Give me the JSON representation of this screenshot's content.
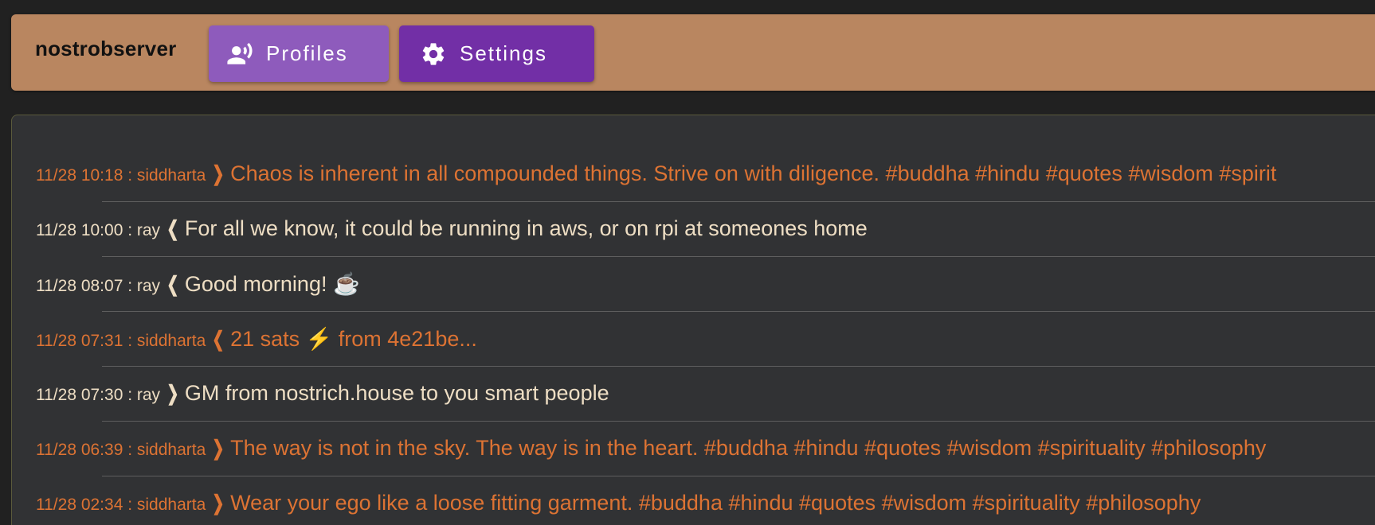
{
  "appbar": {
    "title": "nostrobserver",
    "profiles_label": "Profiles",
    "settings_label": "Settings",
    "color": "#b98660",
    "profiles_color": "#8e5bbc",
    "settings_color": "#722fa6"
  },
  "feed": {
    "notes": [
      {
        "meta": "11/28 10:18 : siddharta",
        "arrow": "❯",
        "text": "Chaos is inherent in all compounded things. Strive on with diligence. #buddha #hindu #quotes #wisdom #spirit",
        "color": "#dd7333"
      },
      {
        "meta": "11/28 10:00 : ray",
        "arrow": "❮",
        "text": "For all we know, it could be running in aws, or on rpi at someones home",
        "color": "#eedec4"
      },
      {
        "meta": "11/28 08:07 : ray",
        "arrow": "❮",
        "text": "Good morning! ☕",
        "color": "#eedec4"
      },
      {
        "meta": "11/28 07:31 : siddharta",
        "arrow": "❮",
        "text": "21 sats ⚡ from 4e21be...",
        "color": "#dd7333"
      },
      {
        "meta": "11/28 07:30 : ray",
        "arrow": "❯",
        "text": "GM from nostrich.house to you smart people",
        "color": "#eedec4"
      },
      {
        "meta": "11/28 06:39 : siddharta",
        "arrow": "❯",
        "text": "The way is not in the sky. The way is in the heart. #buddha #hindu #quotes #wisdom #spirituality #philosophy",
        "color": "#dd7333"
      },
      {
        "meta": "11/28 02:34 : siddharta",
        "arrow": "❯",
        "text": "Wear your ego like a loose fitting garment. #buddha #hindu #quotes #wisdom #spirituality #philosophy",
        "color": "#dd7333"
      }
    ]
  }
}
